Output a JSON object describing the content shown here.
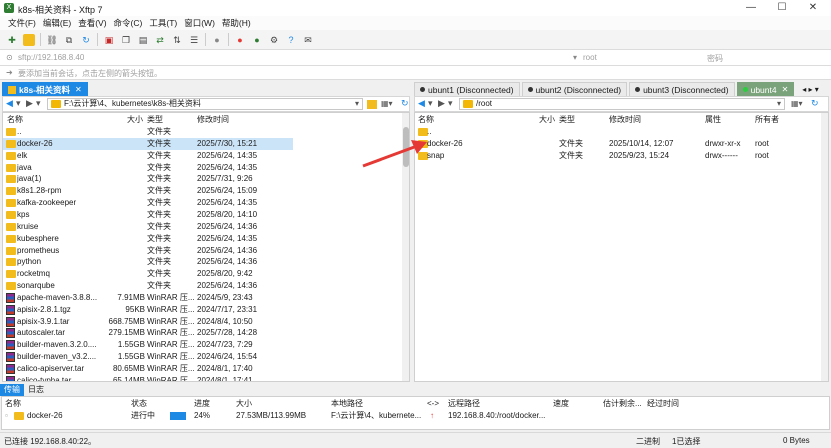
{
  "window": {
    "title": "k8s-相关资料 - Xftp 7",
    "minimize": "—",
    "maximize": "☐",
    "close": "✕"
  },
  "menu": [
    "文件(F)",
    "编辑(E)",
    "查看(V)",
    "命令(C)",
    "工具(T)",
    "窗口(W)",
    "帮助(H)"
  ],
  "address": {
    "url": "sftp://192.168.8.40",
    "user_placeholder": "root",
    "password_placeholder": "密码"
  },
  "hint": "要添加当前会话，点击左侧的箭头按钮。",
  "left": {
    "tab": "k8s-相关资料",
    "path": "F:\\云计算\\4、kubernetes\\k8s-相关资料",
    "columns": [
      "名称",
      "大小",
      "类型",
      "修改时间"
    ],
    "files": [
      {
        "icon": "folder",
        "name": "..",
        "size": "",
        "type": "文件夹",
        "time": ""
      },
      {
        "icon": "folder",
        "name": "docker-26",
        "size": "",
        "type": "文件夹",
        "time": "2025/7/30, 15:21",
        "selected": true
      },
      {
        "icon": "folder",
        "name": "elk",
        "size": "",
        "type": "文件夹",
        "time": "2025/6/24, 14:35"
      },
      {
        "icon": "folder",
        "name": "java",
        "size": "",
        "type": "文件夹",
        "time": "2025/6/24, 14:35"
      },
      {
        "icon": "folder",
        "name": "java(1)",
        "size": "",
        "type": "文件夹",
        "time": "2025/7/31, 9:26"
      },
      {
        "icon": "folder",
        "name": "k8s1.28-rpm",
        "size": "",
        "type": "文件夹",
        "time": "2025/6/24, 15:09"
      },
      {
        "icon": "folder",
        "name": "kafka-zookeeper",
        "size": "",
        "type": "文件夹",
        "time": "2025/6/24, 14:35"
      },
      {
        "icon": "folder",
        "name": "kps",
        "size": "",
        "type": "文件夹",
        "time": "2025/8/20, 14:10"
      },
      {
        "icon": "folder",
        "name": "kruise",
        "size": "",
        "type": "文件夹",
        "time": "2025/6/24, 14:36"
      },
      {
        "icon": "folder",
        "name": "kubesphere",
        "size": "",
        "type": "文件夹",
        "time": "2025/6/24, 14:35"
      },
      {
        "icon": "folder",
        "name": "prometheus",
        "size": "",
        "type": "文件夹",
        "time": "2025/6/24, 14:36"
      },
      {
        "icon": "folder",
        "name": "python",
        "size": "",
        "type": "文件夹",
        "time": "2025/6/24, 14:36"
      },
      {
        "icon": "folder",
        "name": "rocketmq",
        "size": "",
        "type": "文件夹",
        "time": "2025/8/20, 9:42"
      },
      {
        "icon": "folder",
        "name": "sonarqube",
        "size": "",
        "type": "文件夹",
        "time": "2025/6/24, 14:36"
      },
      {
        "icon": "rar",
        "name": "apache-maven-3.8.8...",
        "size": "7.91MB",
        "type": "WinRAR 压...",
        "time": "2024/5/9, 23:43"
      },
      {
        "icon": "rar",
        "name": "apisix-2.8.1.tgz",
        "size": "95KB",
        "type": "WinRAR 压...",
        "time": "2024/7/17, 23:31"
      },
      {
        "icon": "rar",
        "name": "apisix-3.9.1.tar",
        "size": "668.75MB",
        "type": "WinRAR 压...",
        "time": "2024/8/4, 10:50"
      },
      {
        "icon": "rar",
        "name": "autoscaler.tar",
        "size": "279.15MB",
        "type": "WinRAR 压...",
        "time": "2025/7/28, 14:28"
      },
      {
        "icon": "rar",
        "name": "builder-maven.3.2.0....",
        "size": "1.55GB",
        "type": "WinRAR 压...",
        "time": "2024/7/23, 7:29"
      },
      {
        "icon": "rar",
        "name": "builder-maven_v3.2....",
        "size": "1.55GB",
        "type": "WinRAR 压...",
        "time": "2024/6/24, 15:54"
      },
      {
        "icon": "rar",
        "name": "calico-apiserver.tar",
        "size": "80.65MB",
        "type": "WinRAR 压...",
        "time": "2024/8/1, 17:40"
      },
      {
        "icon": "rar",
        "name": "calico-typha.tar",
        "size": "65.14MB",
        "type": "WinRAR 压...",
        "time": "2024/8/1, 17:41"
      }
    ]
  },
  "right": {
    "tabs": [
      {
        "name": "ubunt1 (Disconnected)",
        "status": "disconnected"
      },
      {
        "name": "ubunt2 (Disconnected)",
        "status": "disconnected"
      },
      {
        "name": "ubunt3 (Disconnected)",
        "status": "disconnected"
      },
      {
        "name": "ubunt4",
        "status": "connected"
      }
    ],
    "path": "/root",
    "columns": [
      "名称",
      "大小",
      "类型",
      "修改时间",
      "属性",
      "所有者"
    ],
    "files": [
      {
        "icon": "folder",
        "name": "..",
        "size": "",
        "type": "",
        "time": "",
        "attr": "",
        "owner": ""
      },
      {
        "icon": "folder",
        "name": "docker-26",
        "size": "",
        "type": "文件夹",
        "time": "2025/10/14, 12:07",
        "attr": "drwxr-xr-x",
        "owner": "root"
      },
      {
        "icon": "folder",
        "name": "snap",
        "size": "",
        "type": "文件夹",
        "time": "2025/9/23, 15:24",
        "attr": "drwx------",
        "owner": "root"
      }
    ]
  },
  "bottom_tabs": [
    "传输",
    "日志"
  ],
  "transfer": {
    "columns": [
      "名称",
      "状态",
      "进度",
      "大小",
      "本地路径",
      "<->",
      "远程路径",
      "速度",
      "估计剩余...",
      "经过时间"
    ],
    "rows": [
      {
        "name": "docker-26",
        "status": "进行中",
        "progress_percent": 24,
        "progress_label": "24%",
        "size": "27.53MB/113.99MB",
        "local": "F:\\云计算\\4、kubernete...",
        "direction": "↑",
        "remote": "192.168.8.40:/root/docker...",
        "speed": "",
        "remaining": "",
        "elapsed": ""
      }
    ]
  },
  "status": {
    "left": "已连接 192.168.8.40:22。",
    "mode": "二进制",
    "selected": "1已选择",
    "bytes": "0 Bytes"
  },
  "colors": {
    "accent": "#1e88e5",
    "folder": "#f3bc1d",
    "arrow": "#e53935",
    "selection": "#cce4f7"
  }
}
